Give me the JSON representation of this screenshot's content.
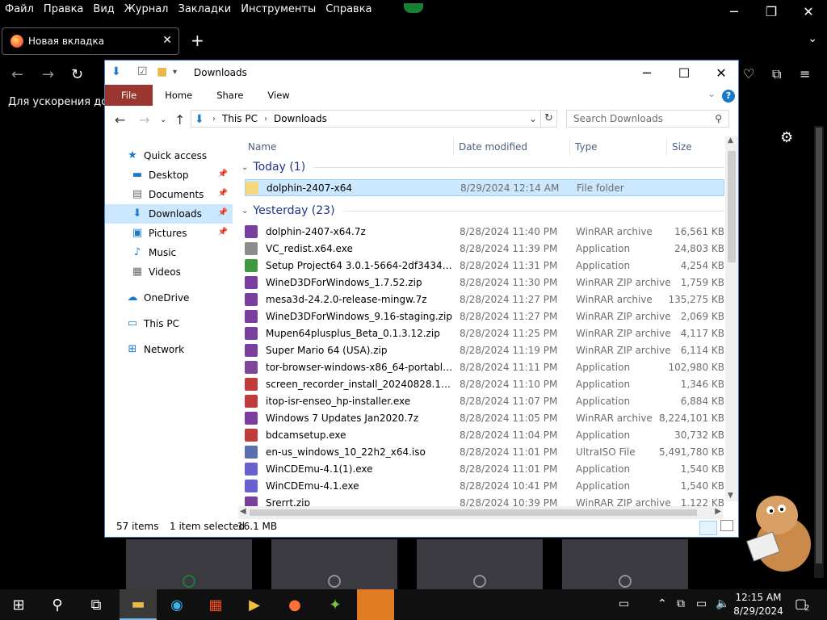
{
  "firefox": {
    "menu": [
      "Файл",
      "Правка",
      "Вид",
      "Журнал",
      "Закладки",
      "Инструменты",
      "Справка"
    ],
    "tab_title": "Новая вкладка",
    "banner_text": "Для ускорения досту"
  },
  "explorer": {
    "title": "Downloads",
    "ribbon_tabs": [
      "File",
      "Home",
      "Share",
      "View"
    ],
    "breadcrumb": [
      "This PC",
      "Downloads"
    ],
    "search_placeholder": "Search Downloads",
    "sidebar": [
      {
        "label": "Quick access",
        "icon": "star-icon",
        "pinned": false,
        "selected": false
      },
      {
        "label": "Desktop",
        "icon": "desktop-icon",
        "pinned": true,
        "selected": false
      },
      {
        "label": "Documents",
        "icon": "documents-icon",
        "pinned": true,
        "selected": false
      },
      {
        "label": "Downloads",
        "icon": "downloads-icon",
        "pinned": true,
        "selected": true
      },
      {
        "label": "Pictures",
        "icon": "pictures-icon",
        "pinned": true,
        "selected": false
      },
      {
        "label": "Music",
        "icon": "music-icon",
        "pinned": false,
        "selected": false
      },
      {
        "label": "Videos",
        "icon": "videos-icon",
        "pinned": false,
        "selected": false
      },
      {
        "label": "OneDrive",
        "icon": "onedrive-icon",
        "pinned": false,
        "selected": false
      },
      {
        "label": "This PC",
        "icon": "this-pc-icon",
        "pinned": false,
        "selected": false
      },
      {
        "label": "Network",
        "icon": "network-icon",
        "pinned": false,
        "selected": false
      }
    ],
    "columns": [
      "Name",
      "Date modified",
      "Type",
      "Size"
    ],
    "groups": [
      {
        "label": "Today (1)",
        "files": [
          {
            "name": "dolphin-2407-x64",
            "date": "8/29/2024 12:14 AM",
            "type": "File folder",
            "size": "",
            "icon": "folder",
            "selected": true
          }
        ]
      },
      {
        "label": "Yesterday (23)",
        "files": [
          {
            "name": "dolphin-2407-x64.7z",
            "date": "8/28/2024 11:40 PM",
            "type": "WinRAR archive",
            "size": "16,561 KB",
            "icon": "rar"
          },
          {
            "name": "VC_redist.x64.exe",
            "date": "8/28/2024 11:39 PM",
            "type": "Application",
            "size": "24,803 KB",
            "icon": "exe"
          },
          {
            "name": "Setup Project64 3.0.1-5664-2df3434.exe",
            "date": "8/28/2024 11:31 PM",
            "type": "Application",
            "size": "4,254 KB",
            "icon": "exe-green"
          },
          {
            "name": "WineD3DForWindows_1.7.52.zip",
            "date": "8/28/2024 11:30 PM",
            "type": "WinRAR ZIP archive",
            "size": "1,759 KB",
            "icon": "rar"
          },
          {
            "name": "mesa3d-24.2.0-release-mingw.7z",
            "date": "8/28/2024 11:27 PM",
            "type": "WinRAR archive",
            "size": "135,275 KB",
            "icon": "rar"
          },
          {
            "name": "WineD3DForWindows_9.16-staging.zip",
            "date": "8/28/2024 11:27 PM",
            "type": "WinRAR ZIP archive",
            "size": "2,069 KB",
            "icon": "rar"
          },
          {
            "name": "Mupen64plusplus_Beta_0.1.3.12.zip",
            "date": "8/28/2024 11:25 PM",
            "type": "WinRAR ZIP archive",
            "size": "4,117 KB",
            "icon": "rar"
          },
          {
            "name": "Super Mario 64 (USA).zip",
            "date": "8/28/2024 11:19 PM",
            "type": "WinRAR ZIP archive",
            "size": "6,114 KB",
            "icon": "rar"
          },
          {
            "name": "tor-browser-windows-x86_64-portable-1...",
            "date": "8/28/2024 11:11 PM",
            "type": "Application",
            "size": "102,980 KB",
            "icon": "tor"
          },
          {
            "name": "screen_recorder_install_20240828.1-17248...",
            "date": "8/28/2024 11:10 PM",
            "type": "Application",
            "size": "1,346 KB",
            "icon": "exe-red"
          },
          {
            "name": "itop-isr-enseo_hp-installer.exe",
            "date": "8/28/2024 11:07 PM",
            "type": "Application",
            "size": "6,884 KB",
            "icon": "exe-red"
          },
          {
            "name": "Windows 7 Updates Jan2020.7z",
            "date": "8/28/2024 11:05 PM",
            "type": "WinRAR archive",
            "size": "8,224,101 KB",
            "icon": "rar"
          },
          {
            "name": "bdcamsetup.exe",
            "date": "8/28/2024 11:04 PM",
            "type": "Application",
            "size": "30,732 KB",
            "icon": "exe-red"
          },
          {
            "name": "en-us_windows_10_22h2_x64.iso",
            "date": "8/28/2024 11:01 PM",
            "type": "UltraISO File",
            "size": "5,491,780 KB",
            "icon": "iso"
          },
          {
            "name": "WinCDEmu-4.1(1).exe",
            "date": "8/28/2024 11:01 PM",
            "type": "Application",
            "size": "1,540 KB",
            "icon": "cd"
          },
          {
            "name": "WinCDEmu-4.1.exe",
            "date": "8/28/2024 10:41 PM",
            "type": "Application",
            "size": "1,540 KB",
            "icon": "cd"
          },
          {
            "name": "Srerrt.zip",
            "date": "8/28/2024 10:39 PM",
            "type": "WinRAR ZIP archive",
            "size": "1,122 KB",
            "icon": "rar"
          }
        ]
      }
    ],
    "status": {
      "items": "57 items",
      "selected": "1 item selected",
      "size": "16.1 MB"
    }
  },
  "taskbar": {
    "time": "12:15 AM",
    "date": "8/29/2024",
    "notif_count": "2"
  },
  "colors": {
    "accent": "#1979ca",
    "selection": "#cce8ff",
    "file_tab": "#9b3530"
  }
}
